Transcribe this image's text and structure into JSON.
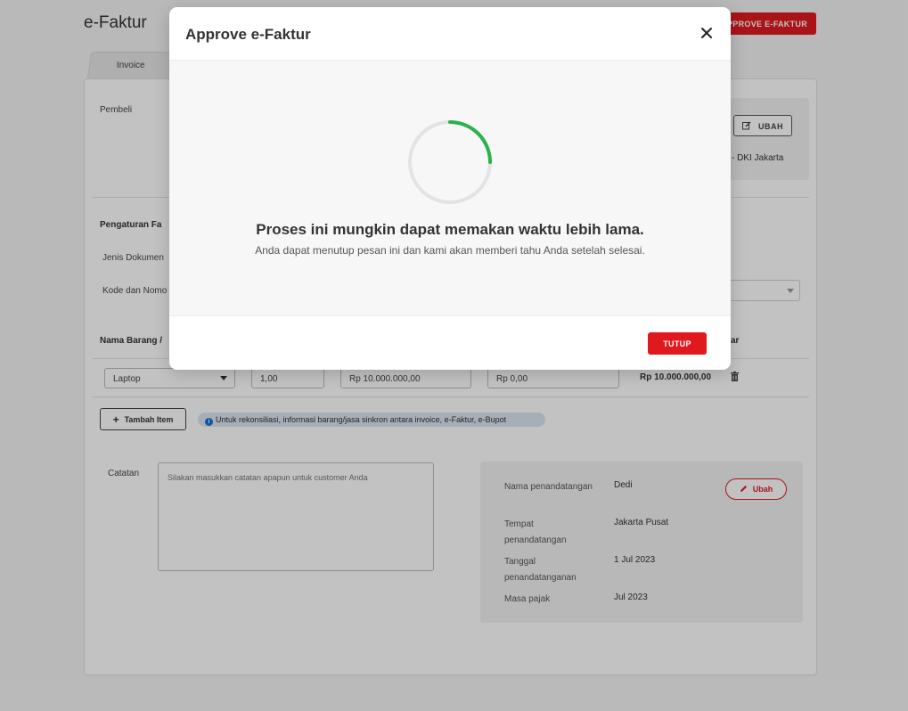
{
  "page": {
    "title": "e-Faktur",
    "approve_button": "APPROVE E-FAKTUR",
    "tab_invoice": "Invoice"
  },
  "buyer": {
    "label": "Pembeli",
    "edit_button": "UBAH",
    "city_fragment": "- DKI Jakarta"
  },
  "settings": {
    "heading_fragment": "Pengaturan Fa",
    "doc_type_label_fragment": "Jenis Dokumen",
    "code_label_fragment": "Kode dan Nomo"
  },
  "items_table": {
    "col_name_fragment": "Nama Barang /",
    "col_last_fragment": "ar",
    "rows": [
      {
        "item": "Laptop",
        "qty": "1,00",
        "price": "Rp 10.000.000,00",
        "discount": "Rp 0,00",
        "total": "Rp 10.000.000,00"
      }
    ],
    "add_item_button": "Tambah Item",
    "info_text": "Untuk rekonsiliasi, informasi barang/jasa sinkron antara invoice, e-Faktur, e-Bupot"
  },
  "notes": {
    "label": "Catatan",
    "placeholder": "Silakan masukkan catatan apapun untuk customer Anda"
  },
  "signature": {
    "name_label": "Nama penandatangan",
    "name_value": "Dedi",
    "place_label": "Tempat penandatangan",
    "place_value": "Jakarta Pusat",
    "date_label": "Tanggal penandatanganan",
    "date_value": "1 Jul 2023",
    "tax_period_label": "Masa pajak",
    "tax_period_value": "Jul 2023",
    "edit_button": "Ubah"
  },
  "modal": {
    "title": "Approve e-Faktur",
    "message": "Proses ini mungkin dapat memakan waktu lebih lama.",
    "submessage": "Anda dapat menutup pesan ini dan kami akan memberi tahu Anda setelah selesai.",
    "close_button": "TUTUP"
  },
  "colors": {
    "primary_red": "#e0191f",
    "spinner_green": "#2bb24c",
    "info_blue": "#1f6fd1"
  }
}
